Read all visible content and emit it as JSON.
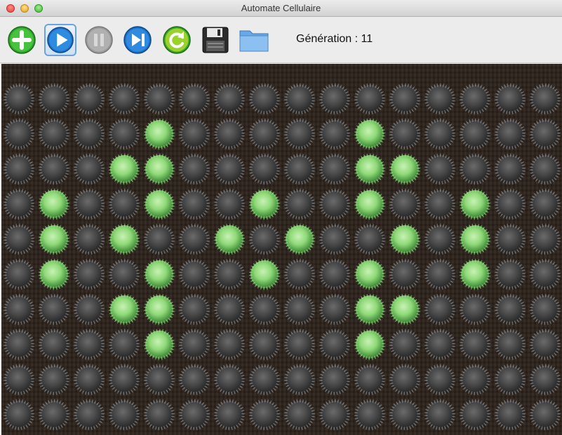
{
  "window": {
    "title": "Automate Cellulaire"
  },
  "toolbar": {
    "buttons": [
      {
        "icon": "plus-icon",
        "name": "add-button",
        "enabled": true,
        "color": "#2fa52b"
      },
      {
        "icon": "play-icon",
        "name": "play-button",
        "enabled": true,
        "selected": true,
        "color": "#1e6fc2"
      },
      {
        "icon": "pause-icon",
        "name": "pause-button",
        "enabled": false,
        "color": "#9a9a9a"
      },
      {
        "icon": "step-forward-icon",
        "name": "step-button",
        "enabled": true,
        "color": "#1e6fc2"
      },
      {
        "icon": "refresh-icon",
        "name": "reset-button",
        "enabled": true,
        "color": "#3aa32e"
      },
      {
        "icon": "floppy-disk-icon",
        "name": "save-button",
        "enabled": true,
        "color": "#333333"
      },
      {
        "icon": "folder-icon",
        "name": "open-button",
        "enabled": true,
        "color": "#4a8fd6"
      }
    ],
    "generation_label": "Génération : 11"
  },
  "board": {
    "rows": 10,
    "cols": 16,
    "alive_cells": [
      [
        1,
        4
      ],
      [
        1,
        10
      ],
      [
        2,
        3
      ],
      [
        2,
        4
      ],
      [
        2,
        10
      ],
      [
        2,
        11
      ],
      [
        3,
        1
      ],
      [
        3,
        4
      ],
      [
        3,
        7
      ],
      [
        3,
        10
      ],
      [
        3,
        13
      ],
      [
        4,
        1
      ],
      [
        4,
        3
      ],
      [
        4,
        6
      ],
      [
        4,
        8
      ],
      [
        4,
        11
      ],
      [
        4,
        13
      ],
      [
        5,
        1
      ],
      [
        5,
        4
      ],
      [
        5,
        7
      ],
      [
        5,
        10
      ],
      [
        5,
        13
      ],
      [
        6,
        3
      ],
      [
        6,
        4
      ],
      [
        6,
        10
      ],
      [
        6,
        11
      ],
      [
        7,
        4
      ],
      [
        7,
        10
      ]
    ],
    "colors": {
      "background": "#2a211b",
      "alive": "#8fd978",
      "dead": "#474747"
    }
  }
}
